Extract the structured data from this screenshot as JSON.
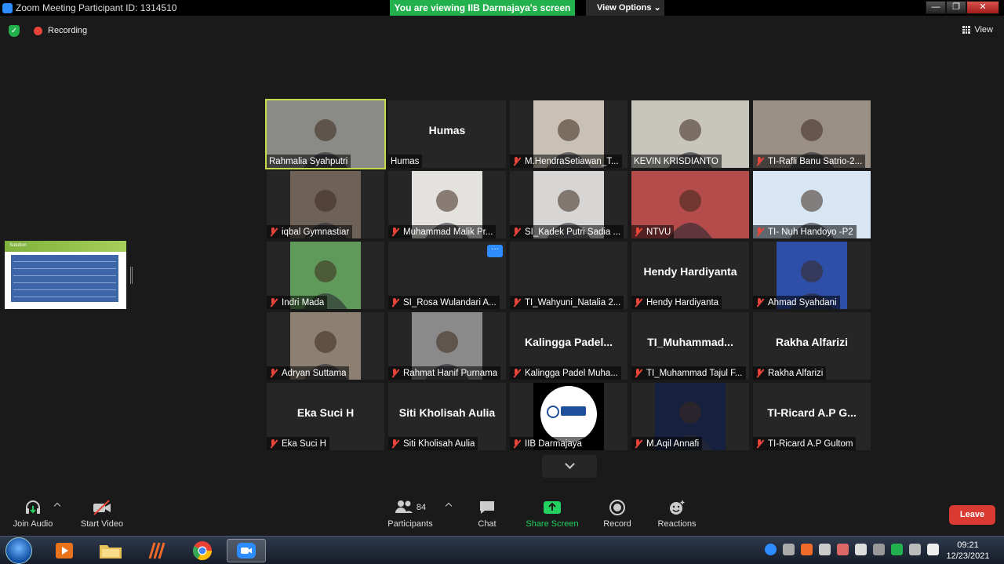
{
  "window": {
    "title": "Zoom Meeting Participant ID: 1314510",
    "banner": "You are viewing IIB Darmajaya's screen",
    "view_options": "View Options",
    "controls": [
      "—",
      "❐",
      "✕"
    ]
  },
  "status": {
    "recording": "Recording",
    "view": "View"
  },
  "shared_screen": {
    "heading": "Solution"
  },
  "participants": [
    {
      "name": "Rahmalia Syahputri",
      "big_name": "",
      "muted": false,
      "video": true,
      "active": true,
      "bg": "#8a8a86"
    },
    {
      "name": "Humas",
      "big_name": "Humas",
      "muted": false,
      "video": false,
      "active": false,
      "bg": ""
    },
    {
      "name": "M.HendraSetiawan_T...",
      "big_name": "",
      "muted": true,
      "video": true,
      "active": false,
      "bg": "#c9c1b4"
    },
    {
      "name": "KEVIN KRISDIANTO",
      "big_name": "",
      "muted": false,
      "video": true,
      "active": false,
      "bg": "#c8c5bd"
    },
    {
      "name": "TI-Rafli Banu Satrio-2...",
      "big_name": "",
      "muted": true,
      "video": true,
      "active": false,
      "bg": "#9a8f85"
    },
    {
      "name": "iqbal Gymnastiar",
      "big_name": "",
      "muted": true,
      "video": true,
      "active": false,
      "bg": "#6e6258"
    },
    {
      "name": "Muhammad Malik Pr...",
      "big_name": "",
      "muted": true,
      "video": true,
      "active": false,
      "bg": "#e4e2de"
    },
    {
      "name": "SI_Kadek Putri Sadia ...",
      "big_name": "",
      "muted": true,
      "video": true,
      "active": false,
      "bg": "#d8d6d4"
    },
    {
      "name": "NTVU",
      "big_name": "",
      "muted": true,
      "video": true,
      "active": false,
      "bg": "#b54b4b"
    },
    {
      "name": "TI- Nuh Handoyo -P2",
      "big_name": "",
      "muted": true,
      "video": true,
      "active": false,
      "bg": "#d7e6f2"
    },
    {
      "name": "Indri Mada",
      "big_name": "",
      "muted": true,
      "video": true,
      "active": false,
      "bg": "#5f9a5a"
    },
    {
      "name": "SI_Rosa Wulandari A...",
      "big_name": "",
      "muted": true,
      "video": false,
      "active": false,
      "bg": "",
      "more": true
    },
    {
      "name": "TI_Wahyuni_Natalia 2...",
      "big_name": "",
      "muted": true,
      "video": false,
      "active": false,
      "bg": ""
    },
    {
      "name": "Hendy Hardiyanta",
      "big_name": "Hendy Hardiyanta",
      "muted": true,
      "video": false,
      "active": false,
      "bg": ""
    },
    {
      "name": "Ahmad Syahdani",
      "big_name": "",
      "muted": true,
      "video": true,
      "active": false,
      "bg": "#2e4fa8"
    },
    {
      "name": "Adryan Suttama",
      "big_name": "",
      "muted": true,
      "video": true,
      "active": false,
      "bg": "#8c8073"
    },
    {
      "name": "Rahmat Hanif Purnama",
      "big_name": "",
      "muted": true,
      "video": true,
      "active": false,
      "bg": "#8a8a8a"
    },
    {
      "name": "Kalingga Padel Muha...",
      "big_name": "Kalingga  Padel...",
      "muted": true,
      "video": false,
      "active": false,
      "bg": ""
    },
    {
      "name": "TI_Muhammad Tajul F...",
      "big_name": "TI_Muhammad...",
      "muted": true,
      "video": false,
      "active": false,
      "bg": ""
    },
    {
      "name": "Rakha Alfarizi",
      "big_name": "Rakha Alfarizi",
      "muted": true,
      "video": false,
      "active": false,
      "bg": ""
    },
    {
      "name": "Eka Suci H",
      "big_name": "Eka Suci H",
      "muted": true,
      "video": false,
      "active": false,
      "bg": ""
    },
    {
      "name": "Siti Kholisah Aulia",
      "big_name": "Siti Kholisah Aulia",
      "muted": true,
      "video": false,
      "active": false,
      "bg": ""
    },
    {
      "name": "IIB Darmajaya",
      "big_name": "",
      "muted": true,
      "video": true,
      "active": false,
      "bg": "#ffffff",
      "logo": true
    },
    {
      "name": "M.Aqil Annafi",
      "big_name": "",
      "muted": true,
      "video": true,
      "active": false,
      "bg": "#16213f"
    },
    {
      "name": "TI-Ricard A.P Gultom",
      "big_name": "TI-Ricard A.P G...",
      "muted": true,
      "video": false,
      "active": false,
      "bg": ""
    }
  ],
  "toolbar": {
    "join_audio": "Join Audio",
    "start_video": "Start Video",
    "participants": "Participants",
    "participant_count": "84",
    "chat": "Chat",
    "share_screen": "Share Screen",
    "record": "Record",
    "reactions": "Reactions",
    "leave": "Leave"
  },
  "taskbar": {
    "time": "09:21",
    "date": "12/23/2021"
  },
  "colors": {
    "green": "#23b14d",
    "leave_red": "#d93a31",
    "active_border": "#c7d94a",
    "zoom_blue": "#2d8cff"
  }
}
